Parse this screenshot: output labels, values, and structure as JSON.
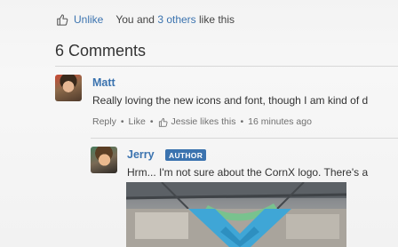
{
  "likes": {
    "unlike_label": "Unlike",
    "prefix": "You and ",
    "others_link": "3 others",
    "suffix": " like this"
  },
  "comments_heading": "6 Comments",
  "comments": [
    {
      "author": "Matt",
      "text": "Really loving the new icons and font, though I am kind of d",
      "reply_label": "Reply",
      "like_label": "Like",
      "likes_text": "Jessie likes this",
      "time": "16 minutes ago"
    },
    {
      "author": "Jerry",
      "badge": "AUTHOR",
      "text": "Hrm... I'm not sure about the CornX logo. There's a"
    }
  ],
  "colors": {
    "link": "#3b73af",
    "badge_bg": "#3b73af"
  },
  "icons": {
    "like": "thumbs-up-icon"
  }
}
